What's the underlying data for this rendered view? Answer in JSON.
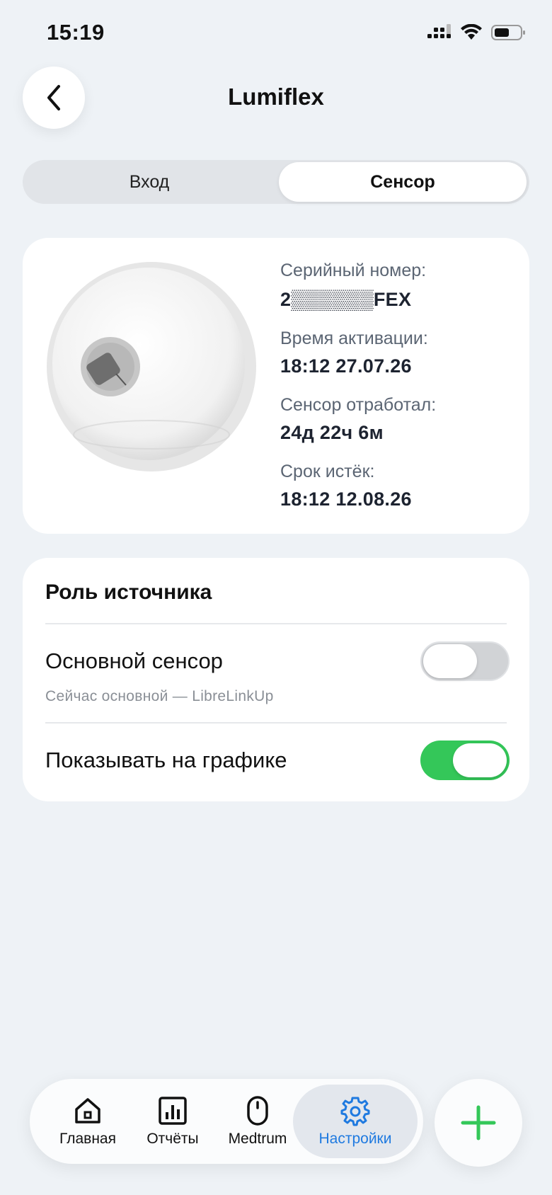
{
  "status_bar": {
    "time": "15:19"
  },
  "header": {
    "title": "Lumiflex"
  },
  "segmented": {
    "tabs": [
      {
        "label": "Вход"
      },
      {
        "label": "Сенсор"
      }
    ]
  },
  "sensor_info": {
    "serial_label": "Серийный номер:",
    "serial_value": "2▒▒▒▒▒▒FEX",
    "activation_label": "Время активации:",
    "activation_value": "18:12 27.07.26",
    "worked_label": "Сенсор отработал:",
    "worked_value": "24д 22ч 6м",
    "expired_label": "Срок истёк:",
    "expired_value": "18:12 12.08.26"
  },
  "source_role": {
    "title": "Роль источника",
    "primary_label": "Основной сенсор",
    "primary_sub": "Сейчас основной — LibreLinkUp",
    "primary_on": false,
    "show_chart_label": "Показывать на графике",
    "show_chart_on": true
  },
  "tabbar": {
    "items": [
      {
        "label": "Главная",
        "icon": "home-icon"
      },
      {
        "label": "Отчёты",
        "icon": "reports-icon"
      },
      {
        "label": "Medtrum",
        "icon": "device-icon"
      },
      {
        "label": "Настройки",
        "icon": "gear-icon"
      }
    ],
    "active": "Настройки"
  },
  "colors": {
    "accent": "#1f7ae0",
    "toggle_on": "#34c759",
    "toggle_off": "#d1d3d6",
    "add": "#34c759"
  }
}
